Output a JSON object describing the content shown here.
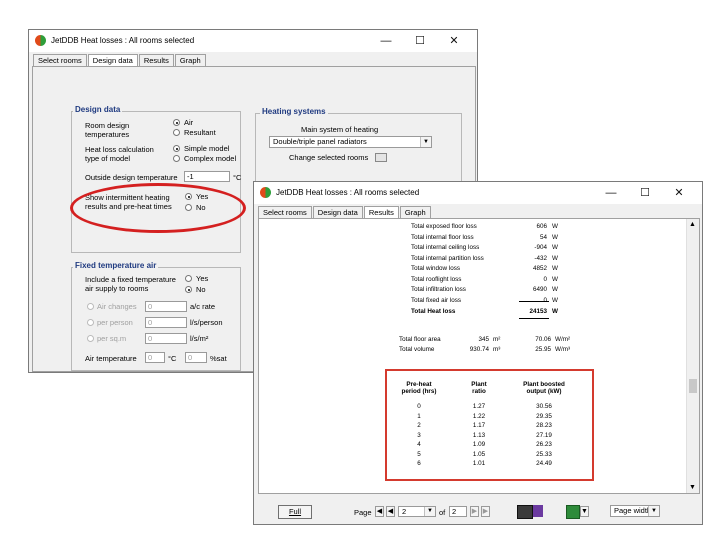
{
  "back_window": {
    "title": "JetDDB Heat losses : All rooms selected",
    "tabs": [
      "Select rooms",
      "Design data",
      "Results",
      "Graph"
    ],
    "active_tab": 1,
    "design_data": {
      "title": "Design data",
      "room_design_temperatures_label": "Room design\ntemperatures",
      "temp_options": [
        "Air",
        "Resultant"
      ],
      "calc_label": "Heat loss calculation\ntype of model",
      "calc_options": [
        "Simple model",
        "Complex model"
      ],
      "outside_temp_label": "Outside design temperature",
      "outside_temp_value": "-1",
      "outside_temp_unit": "°C",
      "intermittent_label": "Show intermittent heating\nresults and pre-heat times",
      "intermittent_options": [
        "Yes",
        "No"
      ]
    },
    "fixed_air": {
      "title": "Fixed temperature air",
      "include_label": "Include a fixed temperature\nair supply to rooms",
      "include_options": [
        "Yes",
        "No"
      ],
      "rows": [
        {
          "label": "Air changes",
          "value": "0",
          "unit": "a/c rate"
        },
        {
          "label": "per person",
          "value": "0",
          "unit": "l/s/person"
        },
        {
          "label": "per sq.m",
          "value": "0",
          "unit": "l/s/m²"
        }
      ],
      "air_temp_label": "Air temperature",
      "air_temp_value": "0",
      "air_temp_unit": "°C",
      "sat_value": "0",
      "sat_unit": "%sat"
    },
    "heating_systems": {
      "title": "Heating systems",
      "main_label": "Main system of heating",
      "main_value": "Double/triple panel radiators",
      "change_label": "Change selected rooms"
    }
  },
  "front_window": {
    "title": "JetDDB Heat losses : All rooms selected",
    "tabs": [
      "Select rooms",
      "Design data",
      "Results",
      "Graph"
    ],
    "active_tab": 2,
    "losses": [
      {
        "label": "Total exposed floor loss",
        "value": "606",
        "unit": "W"
      },
      {
        "label": "Total internal floor loss",
        "value": "54",
        "unit": "W"
      },
      {
        "label": "Total internal ceiling loss",
        "value": "-904",
        "unit": "W"
      },
      {
        "label": "Total internal partition loss",
        "value": "-432",
        "unit": "W"
      },
      {
        "label": "Total window loss",
        "value": "4852",
        "unit": "W"
      },
      {
        "label": "Total rooflight loss",
        "value": "0",
        "unit": "W"
      },
      {
        "label": "Total infiltration loss",
        "value": "6490",
        "unit": "W"
      },
      {
        "label": "Total fixed air loss",
        "value": "0",
        "unit": "W"
      }
    ],
    "total": {
      "label": "Total Heat loss",
      "value": "24153",
      "unit": "W"
    },
    "floor_area": {
      "label": "Total floor area",
      "value": "345",
      "unit": "m²",
      "value2": "70.06",
      "unit2": "W/m²"
    },
    "volume": {
      "label": "Total volume",
      "value": "930.74",
      "unit": "m³",
      "value2": "25.95",
      "unit2": "W/m³"
    },
    "preheat": {
      "headers": [
        "Pre-heat\nperiod (hrs)",
        "Plant\nratio",
        "Plant boosted\noutput (kW)"
      ],
      "rows": [
        [
          "0",
          "1.27",
          "30.56"
        ],
        [
          "1",
          "1.22",
          "29.35"
        ],
        [
          "2",
          "1.17",
          "28.23"
        ],
        [
          "3",
          "1.13",
          "27.19"
        ],
        [
          "4",
          "1.09",
          "26.23"
        ],
        [
          "5",
          "1.05",
          "25.33"
        ],
        [
          "6",
          "1.01",
          "24.49"
        ]
      ]
    },
    "footer": {
      "full_label": "Full",
      "page_label": "Page",
      "page_value": "2",
      "of_label": "of",
      "of_value": "2",
      "zoom_value": "Page width"
    }
  },
  "colors": {
    "highlight": "#d42020",
    "group_title": "#1f3a80"
  }
}
